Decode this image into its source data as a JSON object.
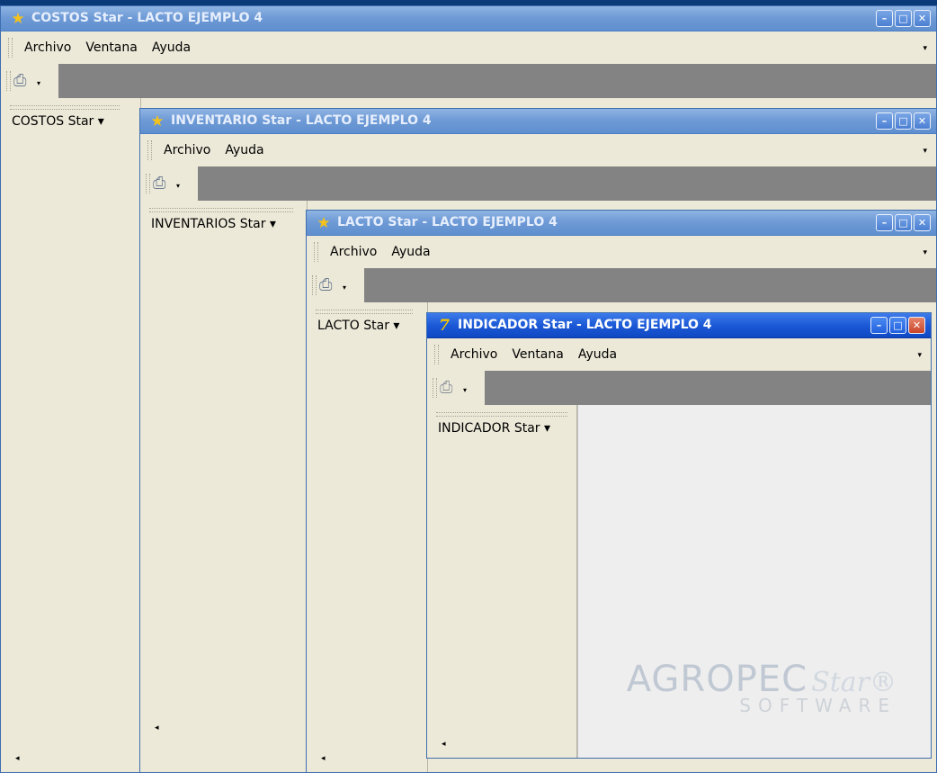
{
  "windows": [
    {
      "id": "costos",
      "title": "COSTOS Star - LACTO EJEMPLO 4",
      "icon": "star-icon",
      "menu": [
        "Archivo",
        "Ventana",
        "Ayuda"
      ],
      "side_label": "COSTOS Star ▾"
    },
    {
      "id": "inventario",
      "title": "INVENTARIO Star - LACTO EJEMPLO 4",
      "icon": "star-icon",
      "menu": [
        "Archivo",
        "Ayuda"
      ],
      "side_label": "INVENTARIOS Star ▾"
    },
    {
      "id": "lacto",
      "title": "LACTO Star - LACTO EJEMPLO 4",
      "icon": "star-icon",
      "menu": [
        "Archivo",
        "Ayuda"
      ],
      "side_label": "LACTO Star ▾"
    },
    {
      "id": "indicador",
      "title": "INDICADOR Star - LACTO EJEMPLO 4",
      "icon": "indicator-logo-icon",
      "menu": [
        "Archivo",
        "Ventana",
        "Ayuda"
      ],
      "side_label": "INDICADOR Star ▾"
    }
  ],
  "controls": {
    "minimize": "–",
    "maximize": "□",
    "close": "✕"
  },
  "icons": {
    "star": "★",
    "indicator": "7",
    "printer": "⎙",
    "dropdown": "▾",
    "chevron": "▾",
    "scroll_left": "◂"
  },
  "logo": {
    "main": "AGROPEC",
    "star": "Star®",
    "sub": "SOFTWARE"
  }
}
